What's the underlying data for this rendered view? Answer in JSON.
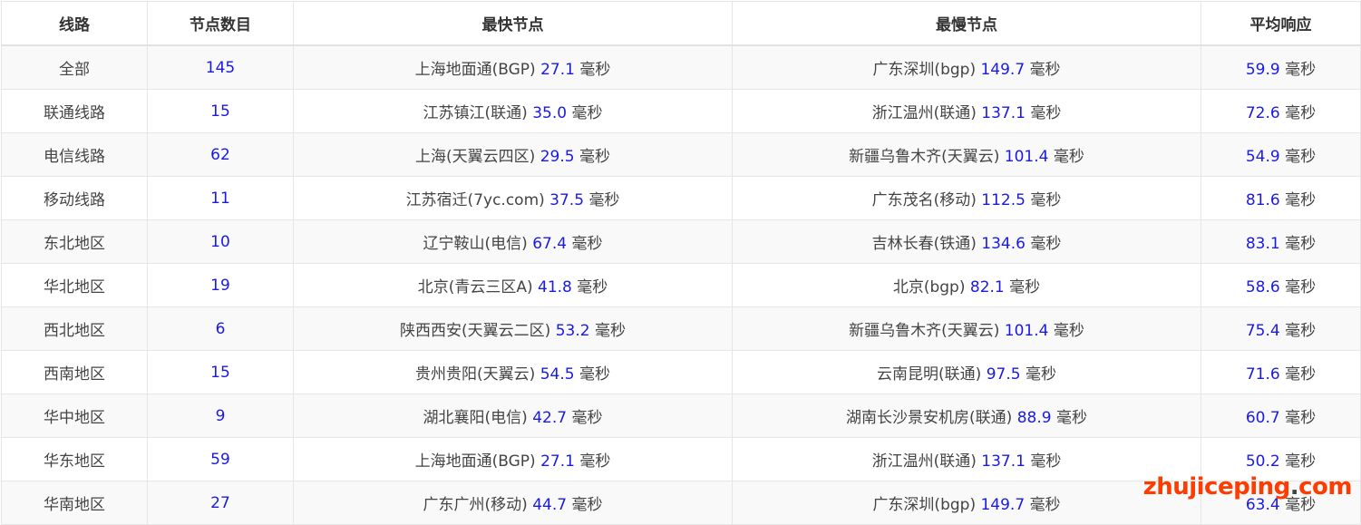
{
  "table": {
    "headers": [
      "线路",
      "节点数目",
      "最快节点",
      "最慢节点",
      "平均响应"
    ],
    "unit": "毫秒",
    "rows": [
      {
        "line": "全部",
        "count": "145",
        "fast_node": "上海地面通(BGP)",
        "fast_ms": "27.1",
        "slow_node": "广东深圳(bgp)",
        "slow_ms": "149.7",
        "avg_ms": "59.9"
      },
      {
        "line": "联通线路",
        "count": "15",
        "fast_node": "江苏镇江(联通)",
        "fast_ms": "35.0",
        "slow_node": "浙江温州(联通)",
        "slow_ms": "137.1",
        "avg_ms": "72.6"
      },
      {
        "line": "电信线路",
        "count": "62",
        "fast_node": "上海(天翼云四区)",
        "fast_ms": "29.5",
        "slow_node": "新疆乌鲁木齐(天翼云)",
        "slow_ms": "101.4",
        "avg_ms": "54.9"
      },
      {
        "line": "移动线路",
        "count": "11",
        "fast_node": "江苏宿迁(7yc.com)",
        "fast_ms": "37.5",
        "slow_node": "广东茂名(移动)",
        "slow_ms": "112.5",
        "avg_ms": "81.6"
      },
      {
        "line": "东北地区",
        "count": "10",
        "fast_node": "辽宁鞍山(电信)",
        "fast_ms": "67.4",
        "slow_node": "吉林长春(铁通)",
        "slow_ms": "134.6",
        "avg_ms": "83.1"
      },
      {
        "line": "华北地区",
        "count": "19",
        "fast_node": "北京(青云三区A)",
        "fast_ms": "41.8",
        "slow_node": "北京(bgp)",
        "slow_ms": "82.1",
        "avg_ms": "58.6"
      },
      {
        "line": "西北地区",
        "count": "6",
        "fast_node": "陕西西安(天翼云二区)",
        "fast_ms": "53.2",
        "slow_node": "新疆乌鲁木齐(天翼云)",
        "slow_ms": "101.4",
        "avg_ms": "75.4"
      },
      {
        "line": "西南地区",
        "count": "15",
        "fast_node": "贵州贵阳(天翼云)",
        "fast_ms": "54.5",
        "slow_node": "云南昆明(联通)",
        "slow_ms": "97.5",
        "avg_ms": "71.6"
      },
      {
        "line": "华中地区",
        "count": "9",
        "fast_node": "湖北襄阳(电信)",
        "fast_ms": "42.7",
        "slow_node": "湖南长沙景安机房(联通)",
        "slow_ms": "88.9",
        "avg_ms": "60.7"
      },
      {
        "line": "华东地区",
        "count": "59",
        "fast_node": "上海地面通(BGP)",
        "fast_ms": "27.1",
        "slow_node": "浙江温州(联通)",
        "slow_ms": "137.1",
        "avg_ms": "50.2"
      },
      {
        "line": "华南地区",
        "count": "27",
        "fast_node": "广东广州(移动)",
        "fast_ms": "44.7",
        "slow_node": "广东深圳(bgp)",
        "slow_ms": "149.7",
        "avg_ms": "63.4"
      }
    ]
  },
  "watermark": {
    "text_a": "zhujiceping",
    "dot": ".",
    "text_b": "com"
  }
}
